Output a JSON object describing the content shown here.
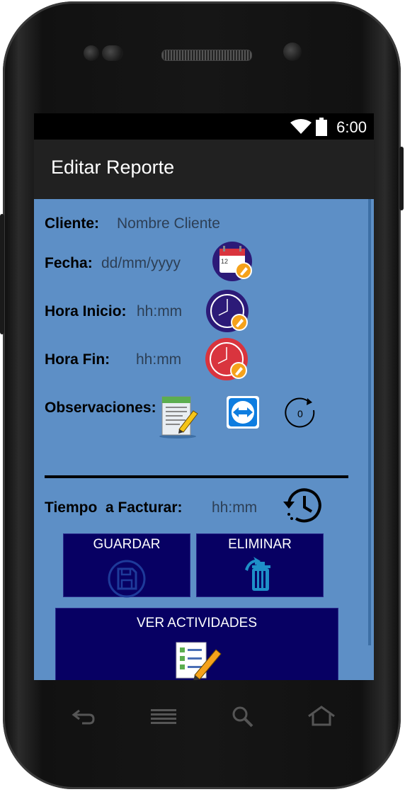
{
  "status": {
    "time": "6:00"
  },
  "appbar": {
    "title": "Editar Reporte"
  },
  "form": {
    "cliente_label": "Cliente:",
    "cliente_value": "Nombre Cliente",
    "fecha_label": "Fecha:",
    "fecha_value": "dd/mm/yyyy",
    "calendar_day": "12",
    "hora_inicio_label": "Hora Inicio:",
    "hora_inicio_value": "hh:mm",
    "hora_fin_label": "Hora Fin:",
    "hora_fin_value": "hh:mm",
    "observaciones_label": "Observaciones:",
    "timer_value": "0",
    "tiempo_label": "Tiempo  a Facturar:",
    "tiempo_value": "hh:mm"
  },
  "buttons": {
    "guardar": "GUARDAR",
    "eliminar": "ELIMINAR",
    "ver_actividades": "VER ACTIVIDADES"
  },
  "colors": {
    "content_bg": "#5d8fc6",
    "button_bg": "#070063",
    "appbar_bg": "#212121",
    "clock_purple": "#2c1a78",
    "clock_red": "#d9343e",
    "accent_orange": "#f5a21b"
  },
  "icons": [
    "wifi-icon",
    "battery-icon",
    "calendar-edit-icon",
    "clock-edit-icon",
    "clock-red-edit-icon",
    "notes-edit-icon",
    "teamviewer-icon",
    "timer-icon",
    "history-clock-icon",
    "floppy-disk-icon",
    "trash-icon",
    "checklist-icon",
    "back-icon",
    "menu-icon",
    "search-icon",
    "home-icon"
  ]
}
